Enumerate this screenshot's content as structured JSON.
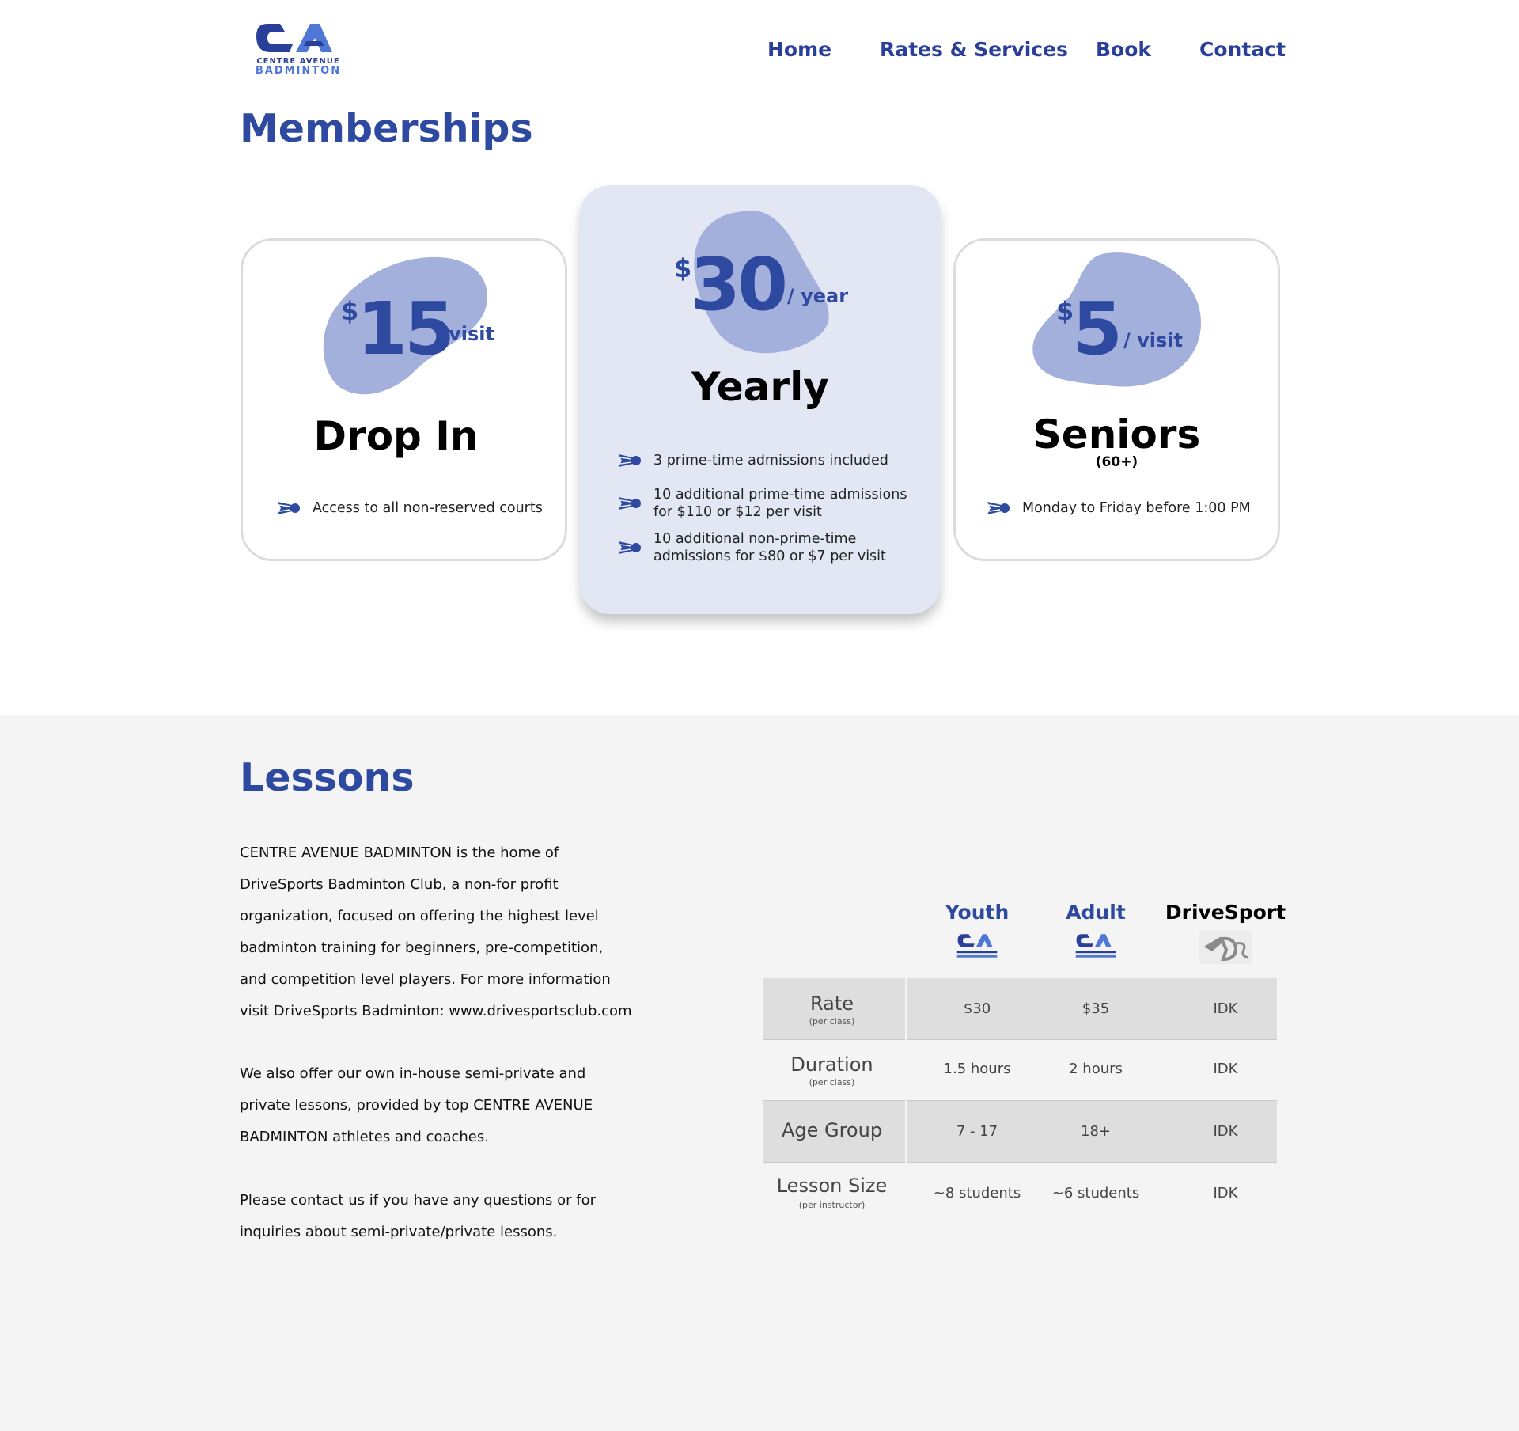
{
  "header": {
    "logo_line1": "CENTRE AVENUE",
    "logo_line2": "BADMINTON",
    "nav": [
      "Home",
      "Rates & Services",
      "Book",
      "Contact"
    ]
  },
  "colors": {
    "brand": "#2e4aa0",
    "brand_light": "#4f78d6",
    "blob": "#a3b0dc",
    "featured_card": "#e3e7f4",
    "lessons_bg": "#f4f4f4"
  },
  "memberships": {
    "title": "Memberships",
    "cards": [
      {
        "currency": "$",
        "amount": "15",
        "per": "/ visit",
        "name": "Drop In",
        "sub": "",
        "features": [
          [
            "Access to all non-reserved courts"
          ]
        ]
      },
      {
        "currency": "$",
        "amount": "30",
        "per": "/ year",
        "name": "Yearly",
        "sub": "",
        "features": [
          [
            "3 prime-time admissions included"
          ],
          [
            "10 additional prime-time admissions",
            "for $110 or $12 per visit"
          ],
          [
            "10 additional non-prime-time",
            "admissions for $80 or $7 per visit"
          ]
        ]
      },
      {
        "currency": "$",
        "amount": "5",
        "per": "/ visit",
        "name": "Seniors",
        "sub": "(60+)",
        "features": [
          [
            "Monday to Friday before 1:00 PM"
          ]
        ]
      }
    ],
    "feature_icon": "shuttlecock-icon"
  },
  "lessons": {
    "title": "Lessons",
    "paragraphs": [
      [
        "CENTRE AVENUE BADMINTON is the home of",
        "DriveSports Badminton Club, a non-for profit",
        "organization, focused on offering the highest level",
        "badminton training for beginners, pre-competition,",
        "and competition level players. For more information",
        "visit DriveSports Badminton: www.drivesportsclub.com"
      ],
      [
        "We also offer our own in-house semi-private and",
        "private lessons, provided by top CENTRE AVENUE",
        "BADMINTON athletes and coaches."
      ],
      [
        "Please contact us if you have any questions or for",
        "inquiries about semi-private/private lessons."
      ]
    ],
    "table": {
      "columns": [
        {
          "label": "Youth",
          "logo": "ca-logo-icon"
        },
        {
          "label": "Adult",
          "logo": "ca-logo-icon"
        },
        {
          "label": "DriveSport",
          "logo": "drivesport-logo-icon"
        }
      ],
      "rows": [
        {
          "label": "Rate",
          "sub": "(per class)",
          "values": [
            "$30",
            "$35",
            "IDK"
          ]
        },
        {
          "label": "Duration",
          "sub": "(per class)",
          "values": [
            "1.5 hours",
            "2 hours",
            "IDK"
          ]
        },
        {
          "label": "Age Group",
          "sub": "",
          "values": [
            "7 - 17",
            "18+",
            "IDK"
          ]
        },
        {
          "label": "Lesson Size",
          "sub": "(per instructor)",
          "values": [
            "~8 students",
            "~6 students",
            "IDK"
          ]
        }
      ]
    }
  }
}
